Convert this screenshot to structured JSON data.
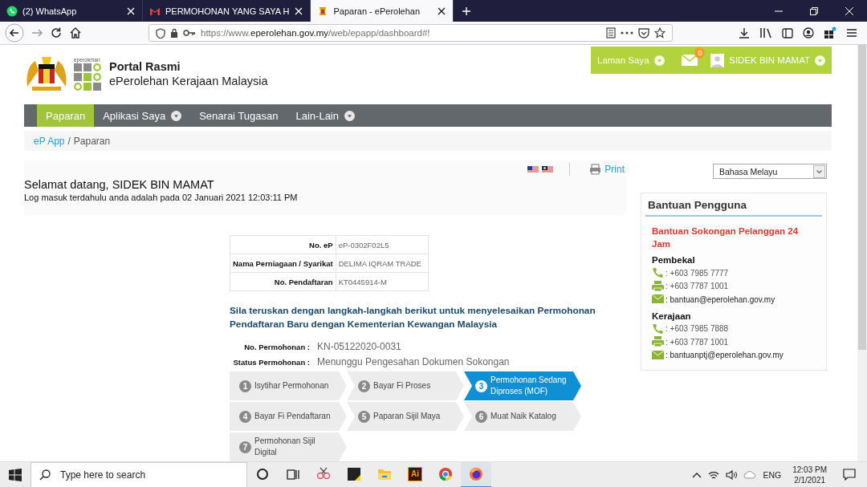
{
  "browser": {
    "tabs": [
      {
        "title": "(2) WhatsApp",
        "selected": false
      },
      {
        "title": "PERMOHONAN YANG SAYA H",
        "selected": false
      },
      {
        "title": "Paparan - ePerolehan",
        "selected": true
      }
    ],
    "url": {
      "scheme": "https://www.",
      "host": "eperolehan.gov.my",
      "path": "/web/epapp/dashboard#!"
    }
  },
  "header": {
    "logo_caption": "eperolehan",
    "title": "Portal Rasmi",
    "subtitle": "ePerolehan Kerajaan Malaysia"
  },
  "user_bar": {
    "home_label": "Laman Saya",
    "mail_count": "0",
    "user_name": "SIDEK BIN MAMAT"
  },
  "menu": [
    {
      "label": "Paparan",
      "selected": true,
      "dropdown": false
    },
    {
      "label": "Aplikasi Saya",
      "selected": false,
      "dropdown": true
    },
    {
      "label": "Senarai Tugasan",
      "selected": false,
      "dropdown": false
    },
    {
      "label": "Lain-Lain",
      "selected": false,
      "dropdown": true
    }
  ],
  "breadcrumb": {
    "separator": "/",
    "items": [
      {
        "label": "eP App",
        "kind": "link"
      },
      {
        "label": "Paparan",
        "kind": "current"
      }
    ]
  },
  "welcome": {
    "greeting": "Selamat datang, SIDEK BIN MAMAT",
    "last_login": "Log masuk terdahulu anda adalah pada 02 Januari 2021 12:03:11 PM",
    "print_label": "Print"
  },
  "profile_table": [
    {
      "label": "No. eP",
      "value": "eP-0302F02L5"
    },
    {
      "label": "Nama Perniagaan / Syarikat",
      "value": "DELIMA IQRAM TRADE"
    },
    {
      "label": "No. Pendaftaran",
      "value": "KT0445914-M"
    }
  ],
  "instruction": "Sila teruskan dengan langkah-langkah berikut untuk menyelesaikan Permohonan Pendaftaran Baru dengan Kementerian Kewangan Malaysia",
  "application": [
    {
      "label": "No. Permohonan :",
      "value": "KN-05122020-0031"
    },
    {
      "label": "Status Permohonan :",
      "value": "Menunggu Pengesahan Dokumen Sokongan"
    }
  ],
  "steps": [
    {
      "number": "1",
      "label": "Isytihar Permohonan",
      "selected": false
    },
    {
      "number": "2",
      "label": "Bayar Fi Proses",
      "selected": false
    },
    {
      "number": "3",
      "label": "Permohonan Sedang Diproses (MOF)",
      "selected": true
    },
    {
      "number": "4",
      "label": "Bayar Fi Pendaftaran",
      "selected": false
    },
    {
      "number": "5",
      "label": "Paparan Sijil Maya",
      "selected": false
    },
    {
      "number": "6",
      "label": "Muat Naik Katalog",
      "selected": false
    },
    {
      "number": "7",
      "label": "Permohonan Sijil Digital",
      "selected": false
    }
  ],
  "language_select": {
    "value": "Bahasa Melayu"
  },
  "help": {
    "title": "Bantuan Pengguna",
    "subtitle": "Bantuan Sokongan Pelanggan 24 Jam",
    "groups": [
      {
        "name": "Pembekal",
        "contacts": [
          {
            "kind": "phone",
            "text": ": +603 7985 7777"
          },
          {
            "kind": "fax",
            "text": ": +603 7787 1001"
          },
          {
            "kind": "email",
            "text": ": bantuan@eperolehan.gov.my"
          }
        ]
      },
      {
        "name": "Kerajaan",
        "contacts": [
          {
            "kind": "phone",
            "text": ": +603 7985 7888"
          },
          {
            "kind": "fax",
            "text": ": +603 7787 1001"
          },
          {
            "kind": "email",
            "text": ": bantuanptj@eperolehan.gov.my"
          }
        ]
      }
    ]
  },
  "taskbar": {
    "search_placeholder": "Type here to search",
    "apps": [
      {
        "kind": "cortana",
        "selected": false
      },
      {
        "kind": "task-view",
        "selected": false
      },
      {
        "kind": "snip",
        "selected": false
      },
      {
        "kind": "sticky",
        "selected": false
      },
      {
        "kind": "folder",
        "selected": false
      },
      {
        "kind": "tile",
        "label": "Ai",
        "selected": false
      },
      {
        "kind": "chrome",
        "selected": false
      },
      {
        "kind": "firefox",
        "selected": true
      }
    ],
    "language": "ENG",
    "time": "12:03 PM",
    "date": "2/1/2021"
  }
}
